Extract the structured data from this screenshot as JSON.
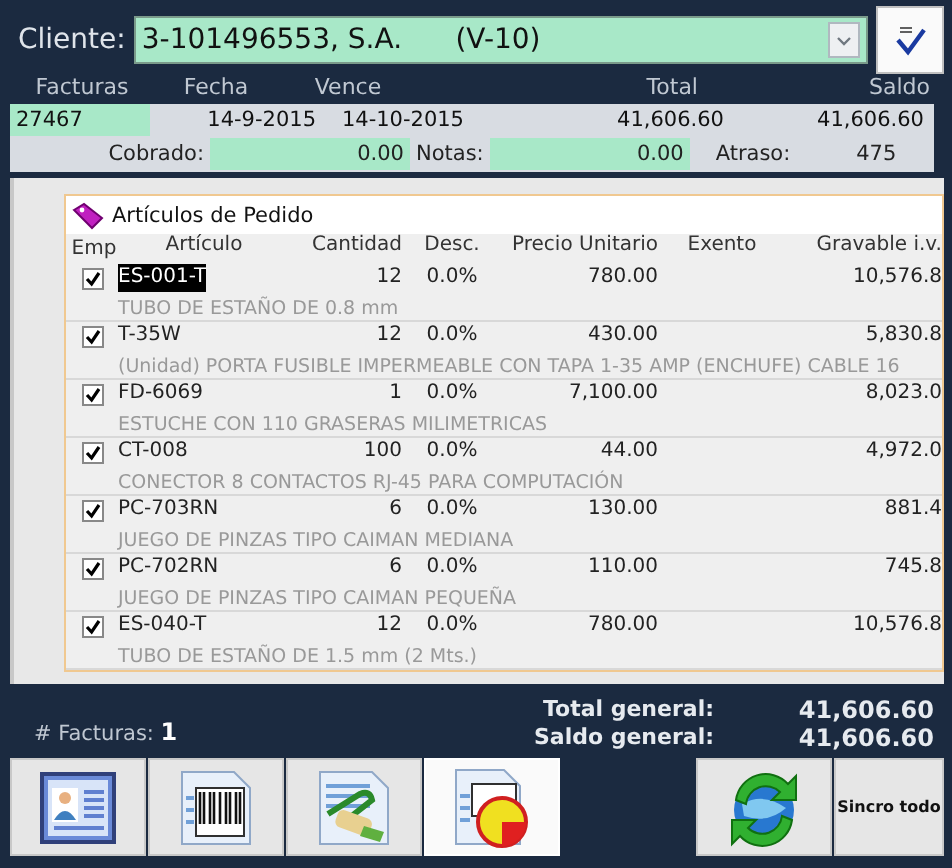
{
  "client": {
    "label": "Cliente:",
    "value": "3-101496553, S.A.      (V-10)"
  },
  "invoices": {
    "columns": [
      "Facturas",
      "Fecha",
      "Vence",
      "Total",
      "Saldo"
    ],
    "rows": [
      {
        "number": "27467",
        "date": "14-9-2015",
        "due": "14-10-2015",
        "total": "41,606.60",
        "balance": "41,606.60",
        "selected": true
      }
    ],
    "cobrado_label": "Cobrado:",
    "cobrado": "0.00",
    "notas_label": "Notas:",
    "notas": "0.00",
    "atraso_label": "Atraso:",
    "atraso": "475"
  },
  "items_panel": {
    "title": "Artículos de Pedido",
    "columns": [
      "Emp",
      "Artículo",
      "Cantidad",
      "Desc.",
      "Precio Unitario",
      "Exento",
      "Gravable i.v."
    ],
    "rows": [
      {
        "checked": true,
        "selected": true,
        "code": "ES-001-T",
        "qty": "12",
        "disc": "0.0%",
        "price": "780.00",
        "taxable": "10,576.8",
        "description": "TUBO DE ESTAÑO  DE 0.8 mm"
      },
      {
        "checked": true,
        "selected": false,
        "code": "T-35W",
        "qty": "12",
        "disc": "0.0%",
        "price": "430.00",
        "taxable": "5,830.8",
        "description": "(Unidad) PORTA FUSIBLE IMPERMEABLE CON TAPA 1-35 AMP (ENCHUFE) CABLE  16"
      },
      {
        "checked": true,
        "selected": false,
        "code": "FD-6069",
        "qty": "1",
        "disc": "0.0%",
        "price": "7,100.00",
        "taxable": "8,023.0",
        "description": "ESTUCHE CON 110 GRASERAS MILIMETRICAS"
      },
      {
        "checked": true,
        "selected": false,
        "code": "CT-008",
        "qty": "100",
        "disc": "0.0%",
        "price": "44.00",
        "taxable": "4,972.0",
        "description": "CONECTOR 8 CONTACTOS RJ-45 PARA COMPUTACIÓN"
      },
      {
        "checked": true,
        "selected": false,
        "code": "PC-703RN",
        "qty": "6",
        "disc": "0.0%",
        "price": "130.00",
        "taxable": "881.4",
        "description": "JUEGO DE PINZAS TIPO CAIMAN MEDIANA"
      },
      {
        "checked": true,
        "selected": false,
        "code": "PC-702RN",
        "qty": "6",
        "disc": "0.0%",
        "price": "110.00",
        "taxable": "745.8",
        "description": "JUEGO DE PINZAS TIPO CAIMAN PEQUEÑA"
      },
      {
        "checked": true,
        "selected": false,
        "code": "ES-040-T",
        "qty": "12",
        "disc": "0.0%",
        "price": "780.00",
        "taxable": "10,576.8",
        "description": "TUBO DE ESTAÑO  DE 1.5  mm (2 Mts.)"
      }
    ]
  },
  "footer": {
    "count_label": "# Facturas:",
    "count": "1",
    "total_label": "Total general:",
    "total": "41,606.60",
    "balance_label": "Saldo general:",
    "balance": "41,606.60"
  },
  "toolbar": [
    {
      "kind": "contact",
      "selected": false
    },
    {
      "kind": "barcode",
      "selected": false
    },
    {
      "kind": "clip",
      "selected": false
    },
    {
      "kind": "chart",
      "selected": true
    },
    {
      "kind": "spacer"
    },
    {
      "kind": "sync",
      "selected": false
    },
    {
      "kind": "text",
      "label": "Sincro todo",
      "selected": false
    }
  ]
}
